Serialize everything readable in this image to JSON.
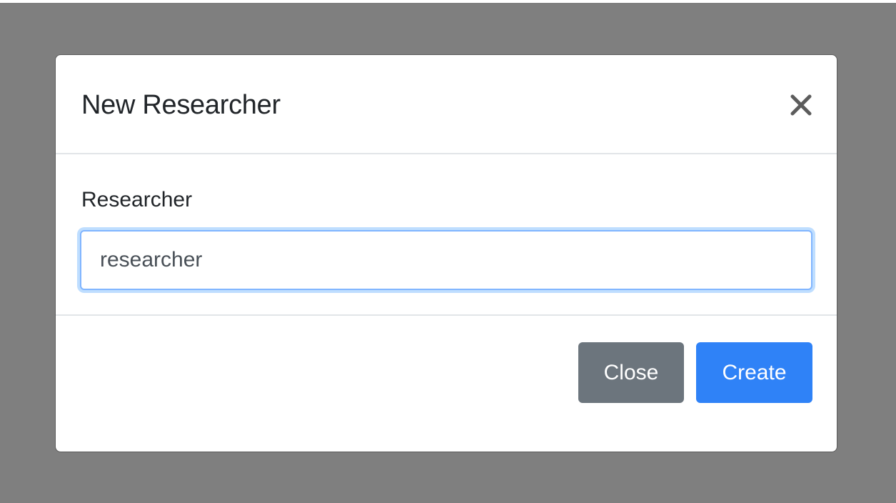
{
  "modal": {
    "title": "New Researcher",
    "close_icon": "close-icon",
    "field": {
      "label": "Researcher",
      "value": "researcher"
    },
    "buttons": {
      "close_label": "Close",
      "create_label": "Create"
    }
  },
  "colors": {
    "backdrop": "#7f7f7f",
    "modal_background": "#ffffff",
    "title_text": "#212529",
    "input_focus_border": "#80b5ff",
    "close_button": "#6c757d",
    "create_button": "#2f82f7"
  }
}
